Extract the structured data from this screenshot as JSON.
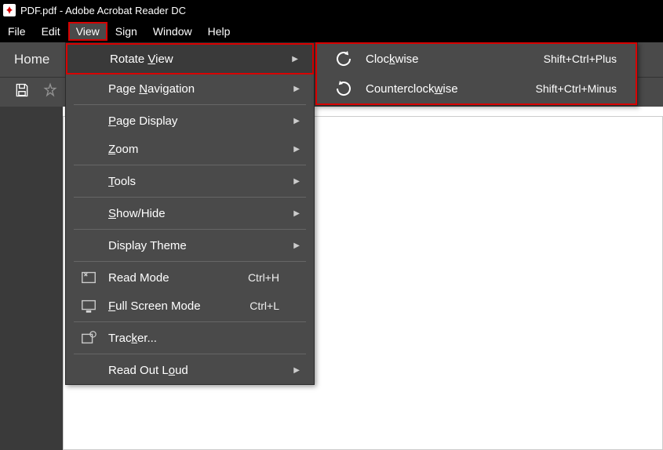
{
  "title": "PDF.pdf - Adobe Acrobat Reader DC",
  "menubar": {
    "file": "File",
    "edit": "Edit",
    "view": "View",
    "sign": "Sign",
    "window": "Window",
    "help": "Help"
  },
  "toolbar": {
    "home": "Home"
  },
  "view_menu": {
    "rotate_view": "Rotate View",
    "page_navigation": "Page Navigation",
    "page_display": "Page Display",
    "zoom": "Zoom",
    "tools": "Tools",
    "show_hide": "Show/Hide",
    "display_theme": "Display Theme",
    "read_mode": "Read Mode",
    "read_mode_sc": "Ctrl+H",
    "full_screen": "Full Screen Mode",
    "full_screen_sc": "Ctrl+L",
    "tracker": "Tracker...",
    "read_out": "Read Out Loud"
  },
  "rotate_sub": {
    "clockwise": "Clockwise",
    "clockwise_sc": "Shift+Ctrl+Plus",
    "ccw": "Counterclockwise",
    "ccw_sc": "Shift+Ctrl+Minus"
  }
}
